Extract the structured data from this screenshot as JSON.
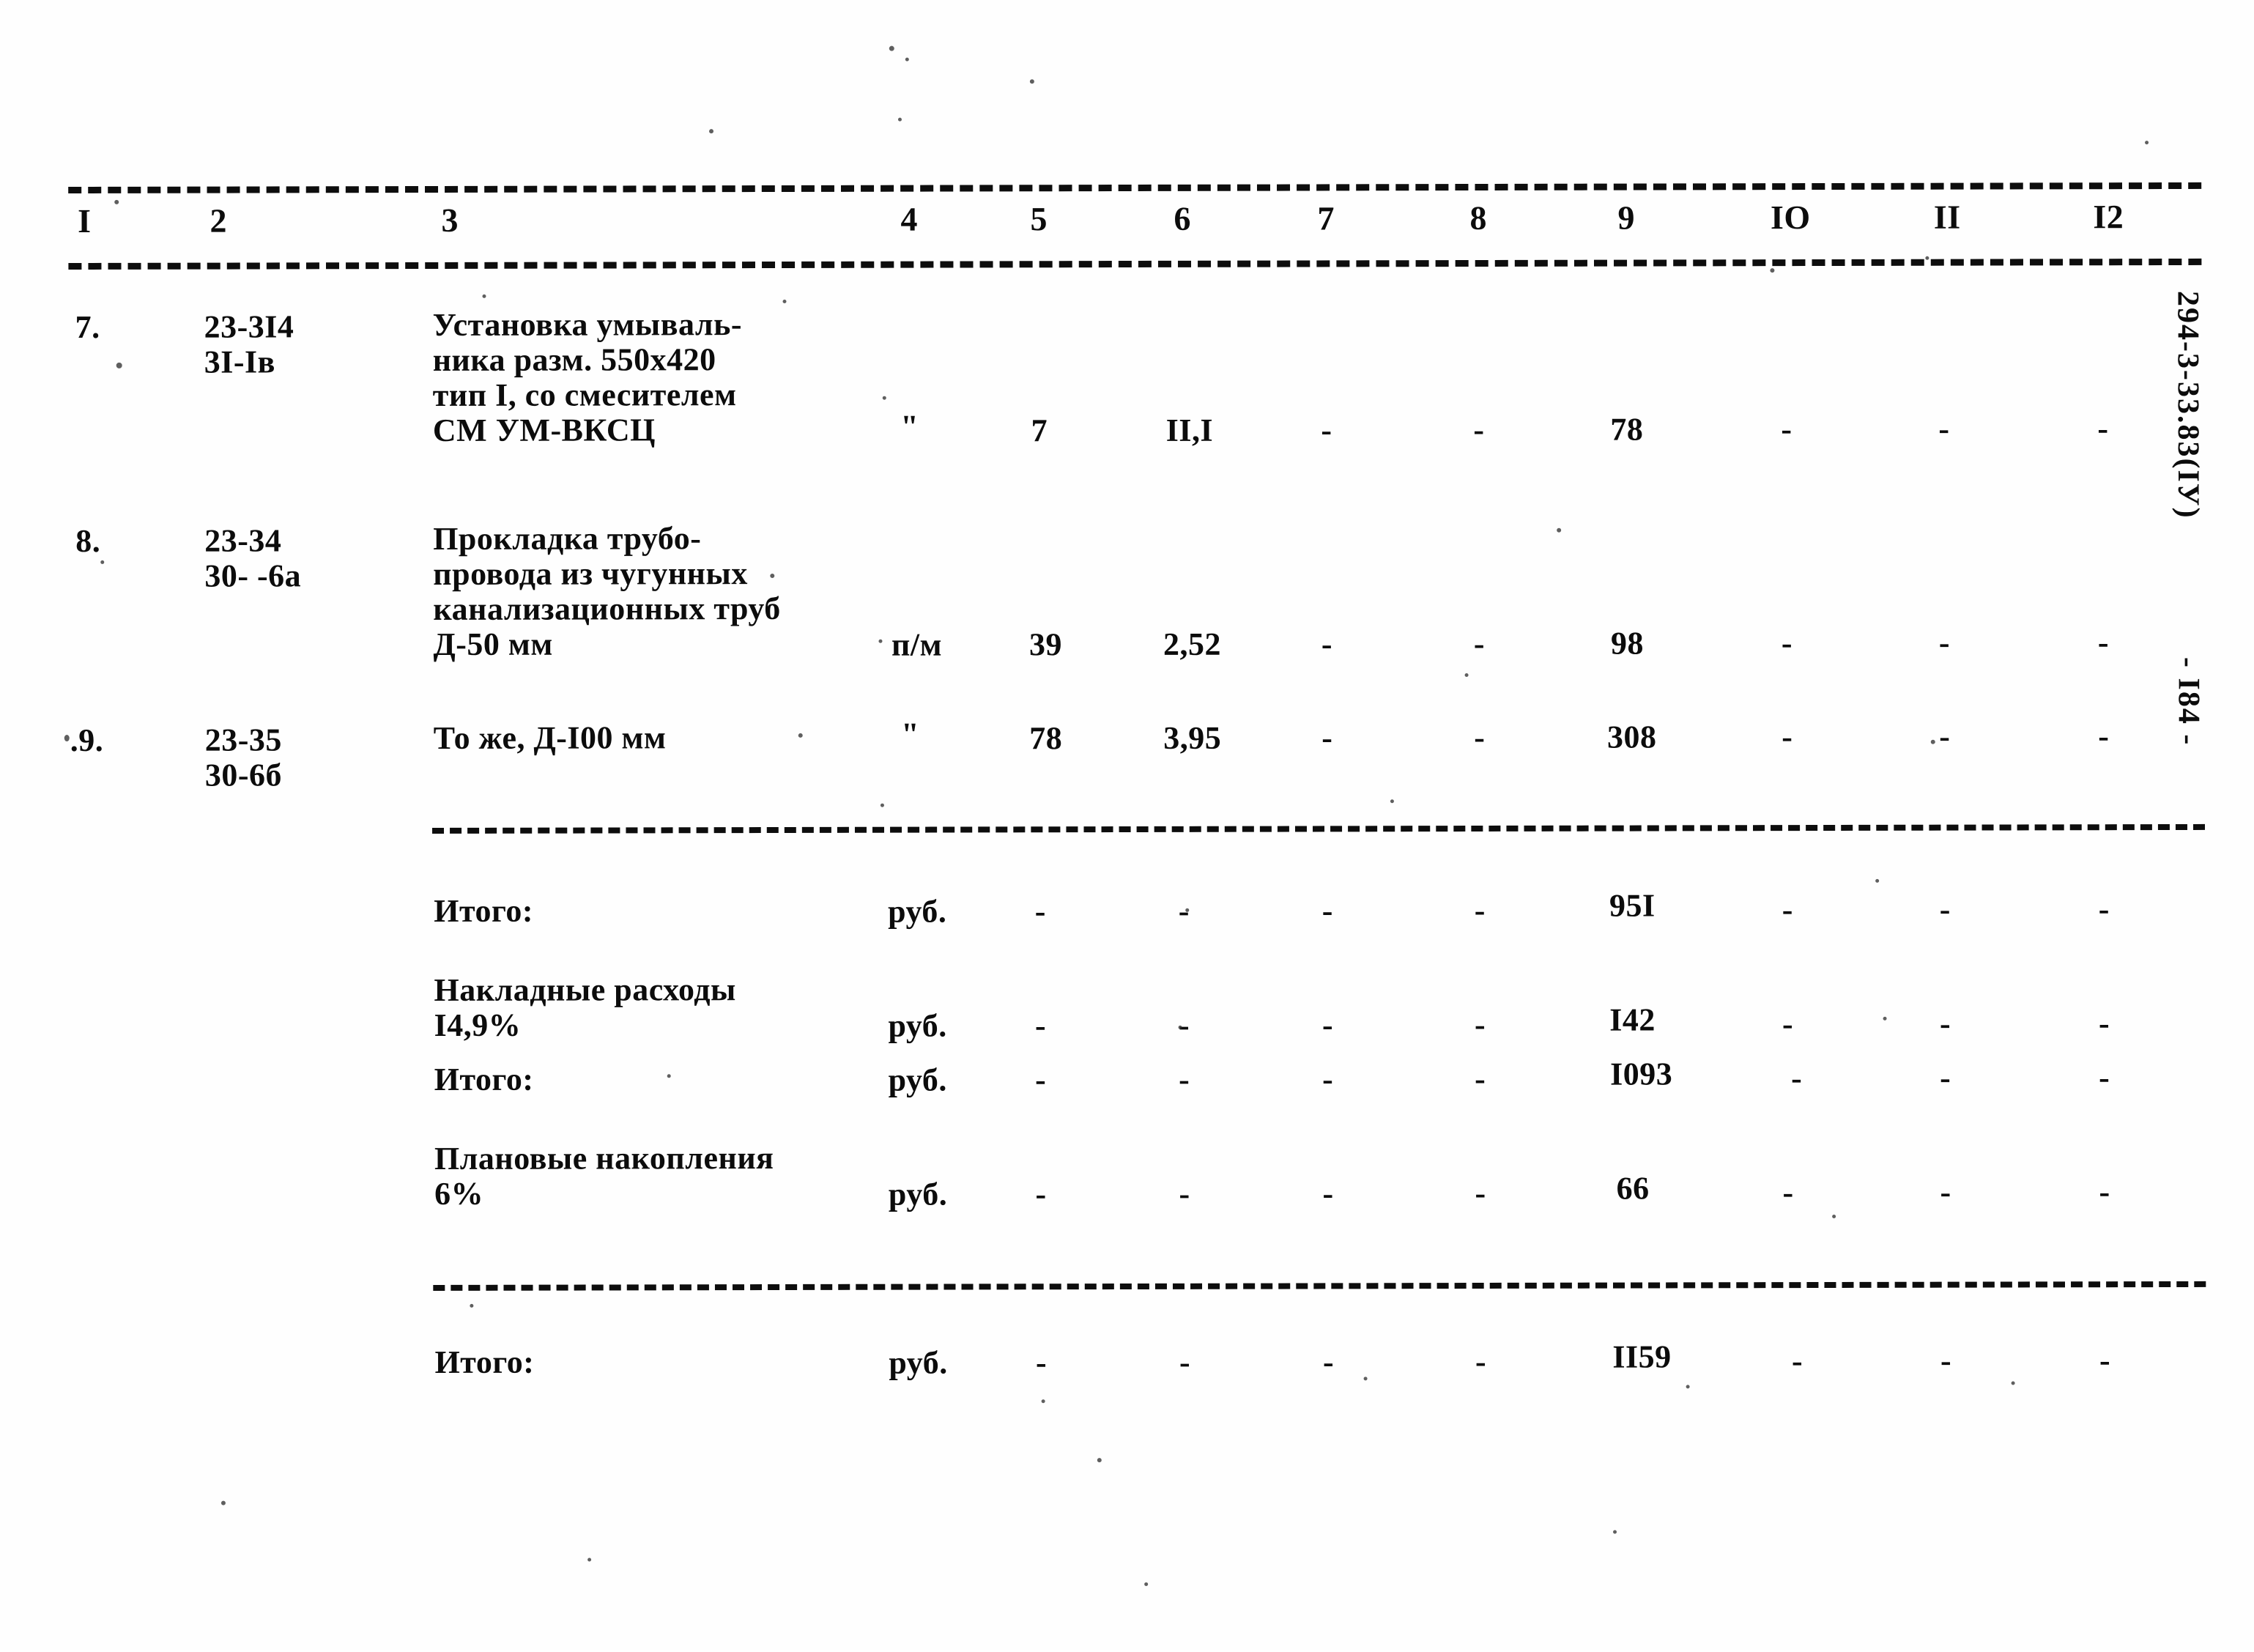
{
  "document": {
    "page_marker": "- I84 -",
    "side_code": "294-3-33.83(IУ)"
  },
  "table": {
    "column_numbers": [
      "I",
      "2",
      "3",
      "4",
      "5",
      "6",
      "7",
      "8",
      "9",
      "IO",
      "II",
      "I2"
    ],
    "rows": [
      {
        "no": "7.",
        "code_lines": [
          "23-3I4",
          "3I-Iв"
        ],
        "description_lines": [
          "Установка умываль-",
          "ника разм. 550х420",
          "тип I, со смесителем",
          "СМ УМ-ВКСЦ"
        ],
        "unit": "\"",
        "c5": "7",
        "c6": "II,I",
        "c7": "-",
        "c8": "-",
        "c9": "78",
        "c10": "-",
        "c11": "-",
        "c12": "-"
      },
      {
        "no": "8.",
        "code_lines": [
          "23-34",
          "30- -6а"
        ],
        "description_lines": [
          "Прокладка трубо-",
          "провода из чугунных",
          "канализационных труб",
          "Д-50 мм"
        ],
        "unit": "п/м",
        "c5": "39",
        "c6": "2,52",
        "c7": "-",
        "c8": "-",
        "c9": "98",
        "c10": "-",
        "c11": "-",
        "c12": "-"
      },
      {
        "no": ".9.",
        "code_lines": [
          "23-35",
          "30-6б"
        ],
        "description_lines": [
          "То же, Д-I00 мм"
        ],
        "unit": "\"",
        "c5": "78",
        "c6": "3,95",
        "c7": "-",
        "c8": "-",
        "c9": "308",
        "c10": "-",
        "c11": "-",
        "c12": "-"
      }
    ],
    "summary_rows": [
      {
        "label_lines": [
          "Итого:"
        ],
        "unit": "руб.",
        "c5": "-",
        "c6": "-",
        "c7": "-",
        "c8": "-",
        "c9": "95I",
        "c10": "-",
        "c11": "-",
        "c12": "-"
      },
      {
        "label_lines": [
          "Накладные расходы",
          "I4,9%"
        ],
        "unit": "руб.",
        "c5": "-",
        "c6": "-",
        "c7": "-",
        "c8": "-",
        "c9": "I42",
        "c10": "-",
        "c11": "-",
        "c12": "-"
      },
      {
        "label_lines": [
          "Итого:"
        ],
        "unit": "руб.",
        "c5": "-",
        "c6": "-",
        "c7": "-",
        "c8": "-",
        "c9": "I093",
        "c10": "-",
        "c11": "-",
        "c12": "-"
      },
      {
        "label_lines": [
          "Плановые накопления",
          "6%"
        ],
        "unit": "руб.",
        "c5": "-",
        "c6": "-",
        "c7": "-",
        "c8": "-",
        "c9": "66",
        "c10": "-",
        "c11": "-",
        "c12": "-"
      }
    ],
    "grand_total": {
      "label_lines": [
        "Итого:"
      ],
      "unit": "руб.",
      "c5": "-",
      "c6": "-",
      "c7": "-",
      "c8": "-",
      "c9": "II59",
      "c10": "-",
      "c11": "-",
      "c12": "-"
    }
  }
}
